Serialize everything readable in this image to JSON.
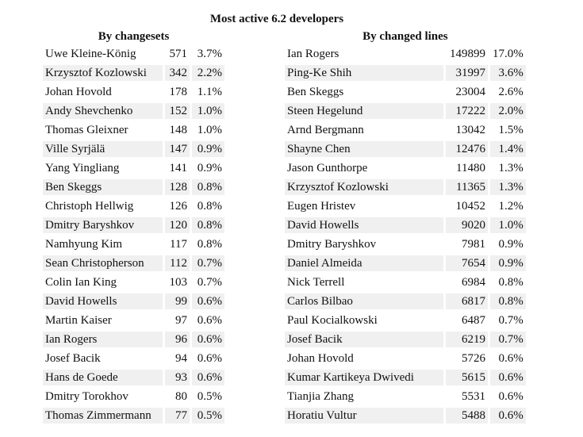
{
  "title": "Most active 6.2 developers",
  "by_changesets": {
    "heading": "By changesets",
    "rows": [
      {
        "name": "Uwe Kleine-König",
        "count": "571",
        "pct": "3.7%"
      },
      {
        "name": "Krzysztof Kozlowski",
        "count": "342",
        "pct": "2.2%"
      },
      {
        "name": "Johan Hovold",
        "count": "178",
        "pct": "1.1%"
      },
      {
        "name": "Andy Shevchenko",
        "count": "152",
        "pct": "1.0%"
      },
      {
        "name": "Thomas Gleixner",
        "count": "148",
        "pct": "1.0%"
      },
      {
        "name": "Ville Syrjälä",
        "count": "147",
        "pct": "0.9%"
      },
      {
        "name": "Yang Yingliang",
        "count": "141",
        "pct": "0.9%"
      },
      {
        "name": "Ben Skeggs",
        "count": "128",
        "pct": "0.8%"
      },
      {
        "name": "Christoph Hellwig",
        "count": "126",
        "pct": "0.8%"
      },
      {
        "name": "Dmitry Baryshkov",
        "count": "120",
        "pct": "0.8%"
      },
      {
        "name": "Namhyung Kim",
        "count": "117",
        "pct": "0.8%"
      },
      {
        "name": "Sean Christopherson",
        "count": "112",
        "pct": "0.7%"
      },
      {
        "name": "Colin Ian King",
        "count": "103",
        "pct": "0.7%"
      },
      {
        "name": "David Howells",
        "count": "99",
        "pct": "0.6%"
      },
      {
        "name": "Martin Kaiser",
        "count": "97",
        "pct": "0.6%"
      },
      {
        "name": "Ian Rogers",
        "count": "96",
        "pct": "0.6%"
      },
      {
        "name": "Josef Bacik",
        "count": "94",
        "pct": "0.6%"
      },
      {
        "name": "Hans de Goede",
        "count": "93",
        "pct": "0.6%"
      },
      {
        "name": "Dmitry Torokhov",
        "count": "80",
        "pct": "0.5%"
      },
      {
        "name": "Thomas Zimmermann",
        "count": "77",
        "pct": "0.5%"
      }
    ]
  },
  "by_changed_lines": {
    "heading": "By changed lines",
    "rows": [
      {
        "name": "Ian Rogers",
        "count": "149899",
        "pct": "17.0%"
      },
      {
        "name": "Ping-Ke Shih",
        "count": "31997",
        "pct": "3.6%"
      },
      {
        "name": "Ben Skeggs",
        "count": "23004",
        "pct": "2.6%"
      },
      {
        "name": "Steen Hegelund",
        "count": "17222",
        "pct": "2.0%"
      },
      {
        "name": "Arnd Bergmann",
        "count": "13042",
        "pct": "1.5%"
      },
      {
        "name": "Shayne Chen",
        "count": "12476",
        "pct": "1.4%"
      },
      {
        "name": "Jason Gunthorpe",
        "count": "11480",
        "pct": "1.3%"
      },
      {
        "name": "Krzysztof Kozlowski",
        "count": "11365",
        "pct": "1.3%"
      },
      {
        "name": "Eugen Hristev",
        "count": "10452",
        "pct": "1.2%"
      },
      {
        "name": "David Howells",
        "count": "9020",
        "pct": "1.0%"
      },
      {
        "name": "Dmitry Baryshkov",
        "count": "7981",
        "pct": "0.9%"
      },
      {
        "name": "Daniel Almeida",
        "count": "7654",
        "pct": "0.9%"
      },
      {
        "name": "Nick Terrell",
        "count": "6984",
        "pct": "0.8%"
      },
      {
        "name": "Carlos Bilbao",
        "count": "6817",
        "pct": "0.8%"
      },
      {
        "name": "Paul Kocialkowski",
        "count": "6487",
        "pct": "0.7%"
      },
      {
        "name": "Josef Bacik",
        "count": "6219",
        "pct": "0.7%"
      },
      {
        "name": "Johan Hovold",
        "count": "5726",
        "pct": "0.6%"
      },
      {
        "name": "Kumar Kartikeya Dwivedi",
        "count": "5615",
        "pct": "0.6%"
      },
      {
        "name": "Tianjia Zhang",
        "count": "5531",
        "pct": "0.6%"
      },
      {
        "name": "Horatiu Vultur",
        "count": "5488",
        "pct": "0.6%"
      }
    ]
  },
  "colors": {
    "alt_row": "#f0f0f0",
    "text": "#111111"
  }
}
